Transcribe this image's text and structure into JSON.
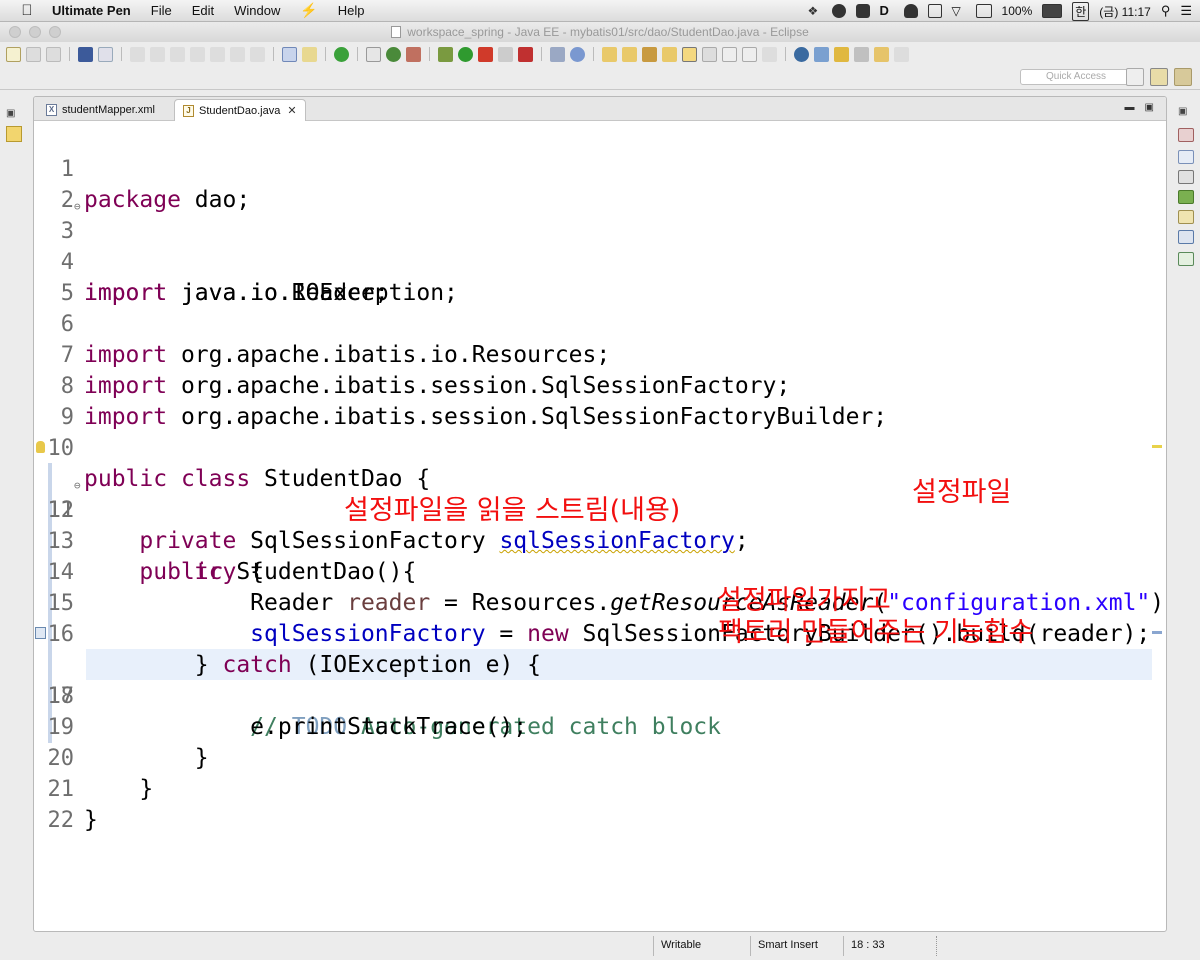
{
  "menubar": {
    "app_name": "Ultimate Pen",
    "items": [
      "File",
      "Edit",
      "Window",
      "Help"
    ],
    "battery": "100%",
    "input_lang": "한",
    "clock": "(금) 11:17"
  },
  "window": {
    "title": "workspace_spring - Java EE - mybatis01/src/dao/StudentDao.java - Eclipse"
  },
  "toolbar": {
    "quick_access_placeholder": "Quick Access"
  },
  "editor": {
    "tabs": [
      {
        "label": "studentMapper.xml",
        "icon": "xml-file-icon",
        "active": false
      },
      {
        "label": "StudentDao.java",
        "icon": "java-file-icon",
        "active": true
      }
    ],
    "line_numbers": [
      "1",
      "2",
      "3",
      "4",
      "5",
      "6",
      "7",
      "8",
      "9",
      "10",
      "11",
      "12",
      "13",
      "14",
      "15",
      "16",
      "17",
      "18",
      "19",
      "20",
      "21",
      "22"
    ],
    "tokens": {
      "package": "package",
      "dao_semi": " dao;",
      "import": "import",
      "io_exception": " java.io.IOException;",
      "io_reader": " java.io.Reader;",
      "resources": " org.apache.ibatis.io.Resources;",
      "sql_factory": " org.apache.ibatis.session.SqlSessionFactory;",
      "sql_builder": " org.apache.ibatis.session.SqlSessionFactoryBuilder;",
      "public": "public",
      "class": "class",
      "student_dao_brace": " StudentDao {",
      "private": "private",
      "factory_type": " SqlSessionFactory ",
      "field_name": "sqlSessionFactory",
      "semi": ";",
      "constructor": " StudentDao(){",
      "try": "try",
      "open_brace": " {",
      "reader_decl": "Reader ",
      "reader_var": "reader",
      "eq_resources": " = Resources.",
      "get_resource": "getResourceAsReader",
      "paren_open": "(",
      "config_str": "\"configuration.xml\"",
      "paren_close_semi": ");",
      "assign_eq": " = ",
      "new": "new",
      "builder_call": " SqlSessionFactoryBuilder().build(reader);",
      "close_brace": "} ",
      "catch": "catch",
      "catch_rest": " (IOException e) {",
      "comment_start": "// ",
      "todo": "TODO",
      "comment_rest": " Auto-generated catch block",
      "print_stack": "e.printStackTrace();",
      "brace": "}"
    },
    "annotations": {
      "stream_note": "설정파일을 읽을 스트림(내용)",
      "config_note": "설정파일",
      "factory_note_1": "설정파일가지고",
      "factory_note_2": "팩토리 만들어주는 기능함수"
    },
    "colors": {
      "keyword": "#7f0055",
      "field": "#0000c0",
      "string": "#2a00ff",
      "comment": "#3f7f5f",
      "todo": "#7f9fbf",
      "annotation": "#f20f0f",
      "current_line": "#e8f0fb"
    }
  },
  "statusbar": {
    "writable": "Writable",
    "insert_mode": "Smart Insert",
    "position": "18 : 33"
  }
}
